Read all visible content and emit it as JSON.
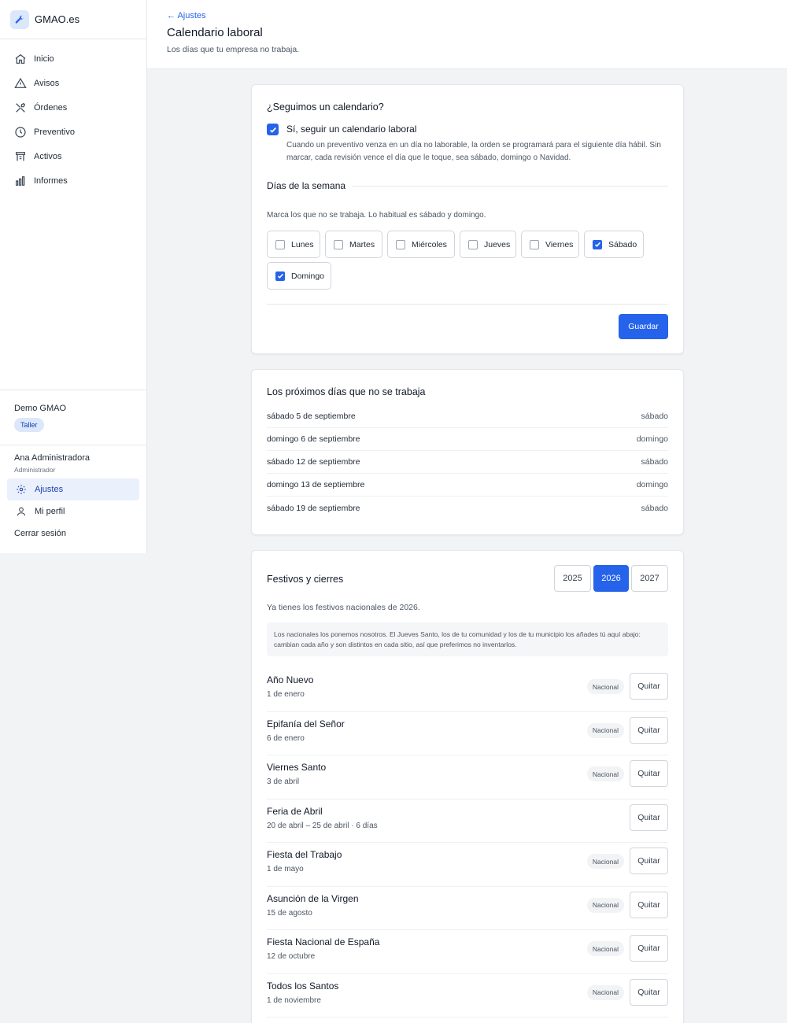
{
  "brand": {
    "name": "GMAO.es",
    "icon": "wrench-icon"
  },
  "nav": [
    {
      "label": "Inicio",
      "icon": "home-icon"
    },
    {
      "label": "Avisos",
      "icon": "warning-icon"
    },
    {
      "label": "Órdenes",
      "icon": "tools-icon"
    },
    {
      "label": "Preventivo",
      "icon": "clock-icon"
    },
    {
      "label": "Activos",
      "icon": "asset-icon"
    },
    {
      "label": "Informes",
      "icon": "bar-chart-icon"
    }
  ],
  "org": {
    "name": "Demo GMAO",
    "badge": "Taller"
  },
  "user": {
    "name": "Ana Administradora",
    "role": "Administrador"
  },
  "side_links": {
    "settings": "Ajustes",
    "profile": "Mi perfil",
    "logout": "Cerrar sesión"
  },
  "header": {
    "back": "← Ajustes",
    "title": "Calendario laboral",
    "subtitle": "Los días que tu empresa no trabaja."
  },
  "calendar": {
    "question": "¿Seguimos un calendario?",
    "follow_label": "Sí, seguir un calendario laboral",
    "follow_checked": true,
    "follow_help": "Cuando un preventivo venza en un día no laborable, la orden se programará para el siguiente día hábil. Sin marcar, cada revisión vence el día que le toque, sea sábado, domingo o Navidad.",
    "section_title": "Días de la semana",
    "days_help": "Marca los que no se trabaja. Lo habitual es sábado y domingo.",
    "days": [
      {
        "label": "Lunes",
        "checked": false
      },
      {
        "label": "Martes",
        "checked": false
      },
      {
        "label": "Miércoles",
        "checked": false
      },
      {
        "label": "Jueves",
        "checked": false
      },
      {
        "label": "Viernes",
        "checked": false
      },
      {
        "label": "Sábado",
        "checked": true
      },
      {
        "label": "Domingo",
        "checked": true
      }
    ],
    "save": "Guardar"
  },
  "next_days": {
    "title": "Los próximos días que no se trabaja",
    "rows": [
      {
        "date": "sábado 5 de septiembre",
        "weekday": "sábado"
      },
      {
        "date": "domingo 6 de septiembre",
        "weekday": "domingo"
      },
      {
        "date": "sábado 12 de septiembre",
        "weekday": "sábado"
      },
      {
        "date": "domingo 13 de septiembre",
        "weekday": "domingo"
      },
      {
        "date": "sábado 19 de septiembre",
        "weekday": "sábado"
      }
    ]
  },
  "holidays": {
    "title": "Festivos y cierres",
    "years": [
      "2025",
      "2026",
      "2027"
    ],
    "active_year": "2026",
    "have_text": "Ya tienes los festivos nacionales de 2026.",
    "note": "Los nacionales los ponemos nosotros. El Jueves Santo, los de tu comunidad y los de tu municipio los añades tú aquí abajo: cambian cada año y son distintos en cada sitio, así que preferimos no inventarlos.",
    "remove_label": "Quitar",
    "items": [
      {
        "name": "Año Nuevo",
        "date": "1 de enero",
        "badge": "Nacional"
      },
      {
        "name": "Epifanía del Señor",
        "date": "6 de enero",
        "badge": "Nacional"
      },
      {
        "name": "Viernes Santo",
        "date": "3 de abril",
        "badge": "Nacional"
      },
      {
        "name": "Feria de Abril",
        "date": "20 de abril – 25 de abril · 6 días",
        "badge": ""
      },
      {
        "name": "Fiesta del Trabajo",
        "date": "1 de mayo",
        "badge": "Nacional"
      },
      {
        "name": "Asunción de la Virgen",
        "date": "15 de agosto",
        "badge": "Nacional"
      },
      {
        "name": "Fiesta Nacional de España",
        "date": "12 de octubre",
        "badge": "Nacional"
      },
      {
        "name": "Todos los Santos",
        "date": "1 de noviembre",
        "badge": "Nacional"
      }
    ]
  },
  "colors": {
    "accent": "#2563eb",
    "accent_soft": "#dbe7fb"
  }
}
